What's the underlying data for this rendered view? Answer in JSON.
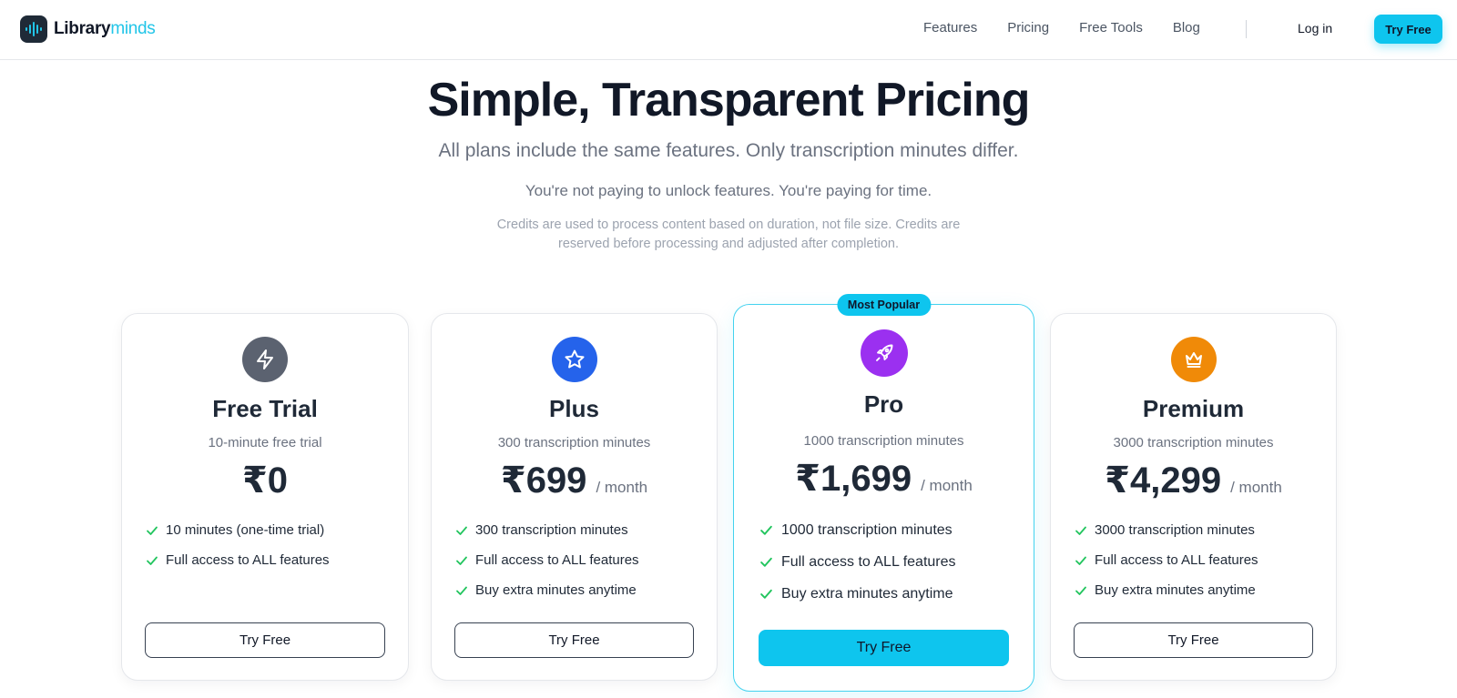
{
  "brand": {
    "name_bold": "Library",
    "name_light": "minds",
    "icon": "soundwave-logo-icon",
    "accent": "#0ec5ee"
  },
  "nav": {
    "links": [
      "Features",
      "Pricing",
      "Free Tools",
      "Blog"
    ],
    "login": "Log in",
    "cta": "Try Free"
  },
  "hero": {
    "title": "Simple, Transparent Pricing",
    "subtitle": "All plans include the same features. Only transcription minutes differ.",
    "subtitle2": "You're not paying to unlock features. You're paying for time.",
    "note": "Credits are used to process content based on duration, not file size. Credits are reserved before processing and adjusted after completion."
  },
  "plans": [
    {
      "name": "Free Trial",
      "minutes": "10-minute free trial",
      "price": "₹0",
      "period": "",
      "icon": "lightning-icon",
      "icon_color": "#5b6270",
      "features": [
        "10 minutes (one-time trial)",
        "Full access to ALL features"
      ],
      "cta": "Try Free"
    },
    {
      "name": "Plus",
      "minutes": "300 transcription minutes",
      "price": "₹699",
      "period": "/ month",
      "icon": "star-icon",
      "icon_color": "#2563eb",
      "features": [
        "300 transcription minutes",
        "Full access to ALL features",
        "Buy extra minutes anytime"
      ],
      "cta": "Try Free"
    },
    {
      "name": "Pro",
      "minutes": "1000 transcription minutes",
      "price": "₹1,699",
      "period": "/ month",
      "icon": "rocket-icon",
      "icon_color": "#9b30f0",
      "badge": "Most Popular",
      "features": [
        "1000 transcription minutes",
        "Full access to ALL features",
        "Buy extra minutes anytime"
      ],
      "cta": "Try Free"
    },
    {
      "name": "Premium",
      "minutes": "3000 transcription minutes",
      "price": "₹4,299",
      "period": "/ month",
      "icon": "crown-icon",
      "icon_color": "#f08a08",
      "features": [
        "3000 transcription minutes",
        "Full access to ALL features",
        "Buy extra minutes anytime"
      ],
      "cta": "Try Free"
    }
  ]
}
